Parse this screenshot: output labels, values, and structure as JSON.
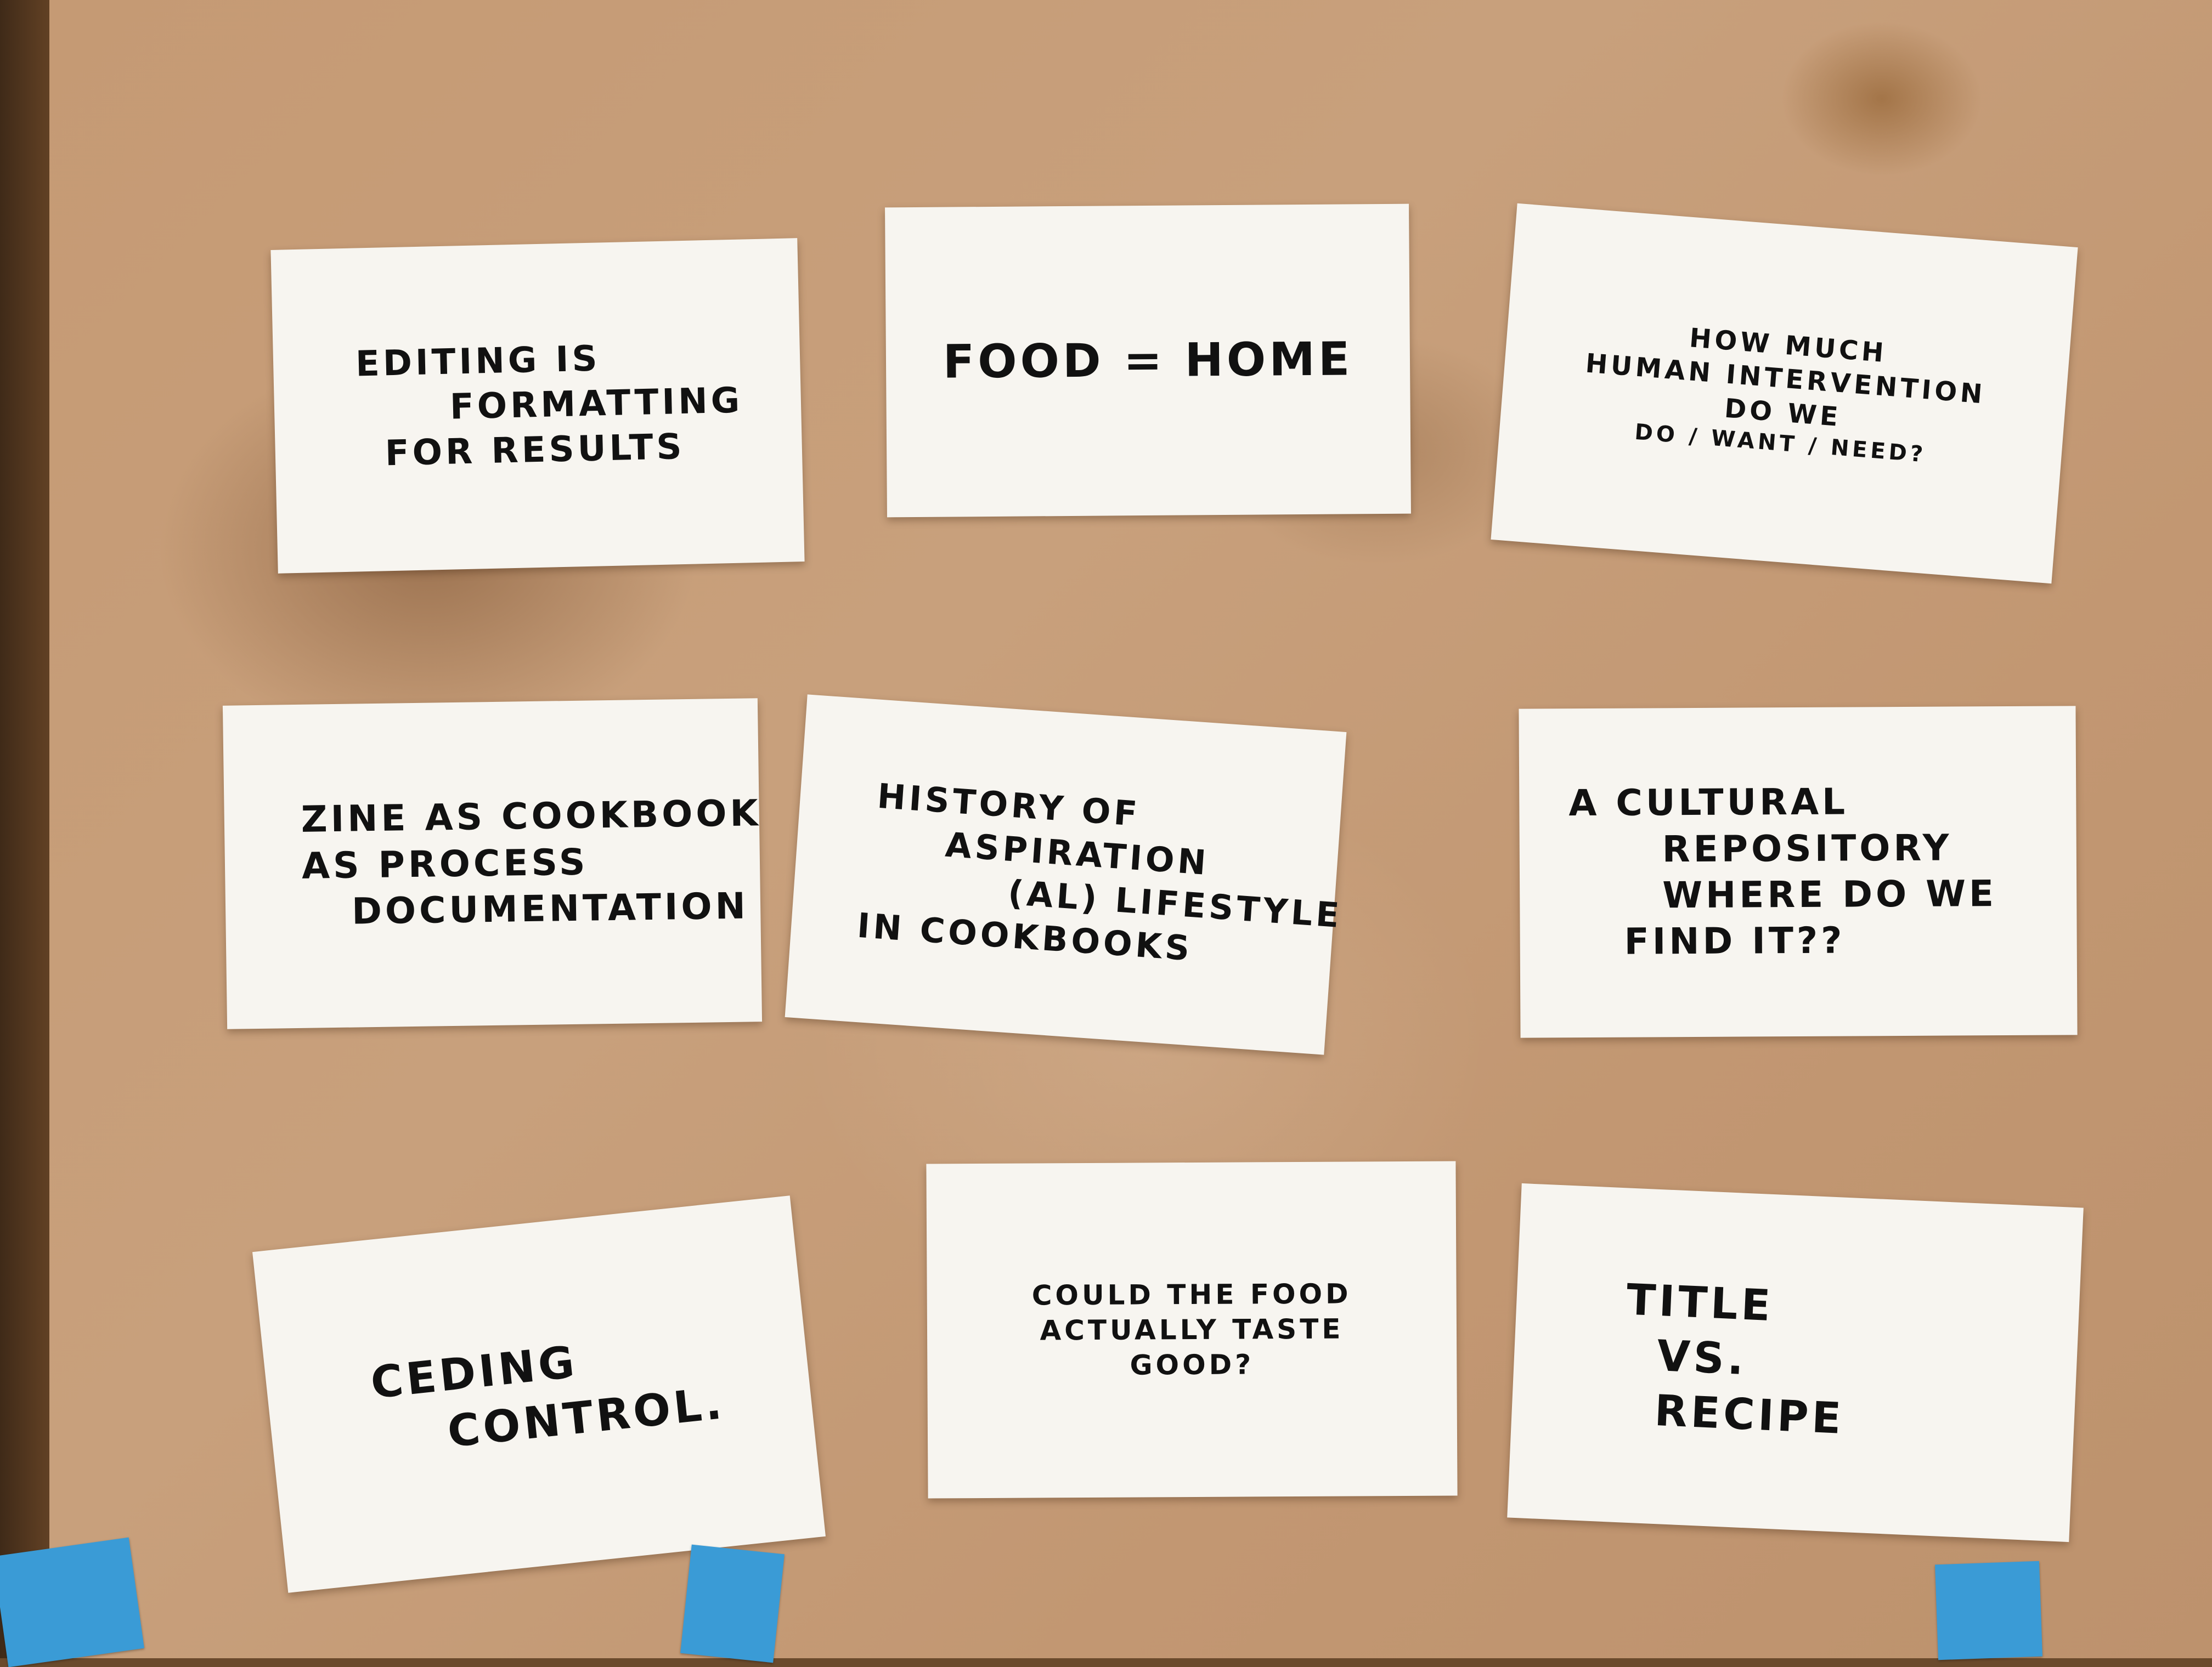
{
  "cards": [
    {
      "lines": [
        "EDITING IS",
        "FORMATTING",
        "FOR RESULTS"
      ]
    },
    {
      "lines": [
        "FOOD = HOME"
      ]
    },
    {
      "lines": [
        "HOW MUCH",
        "HUMAN INTERVENTION",
        "DO WE",
        "DO / WANT / NEED?"
      ]
    },
    {
      "lines": [
        "ZINE AS COOKBOOK",
        "AS PROCESS",
        "DOCUMENTATION"
      ]
    },
    {
      "lines": [
        "HISTORY OF",
        "ASPIRATION",
        "(AL) LIFESTYLE",
        "IN COOKBOOKS"
      ]
    },
    {
      "lines": [
        "A CULTURAL",
        "REPOSITORY",
        "WHERE DO WE",
        "FIND IT??"
      ]
    },
    {
      "lines": [
        "CEDING",
        "CONTROL."
      ]
    },
    {
      "lines": [
        "COULD THE FOOD",
        "ACTUALLY TASTE",
        "GOOD?"
      ]
    },
    {
      "lines": [
        "TITLE",
        "VS.",
        "RECIPE"
      ]
    }
  ],
  "colors": {
    "paper": "#c59a74",
    "card": "#f7f5f0",
    "ink": "#111111",
    "tape": "#3a9bd6"
  }
}
